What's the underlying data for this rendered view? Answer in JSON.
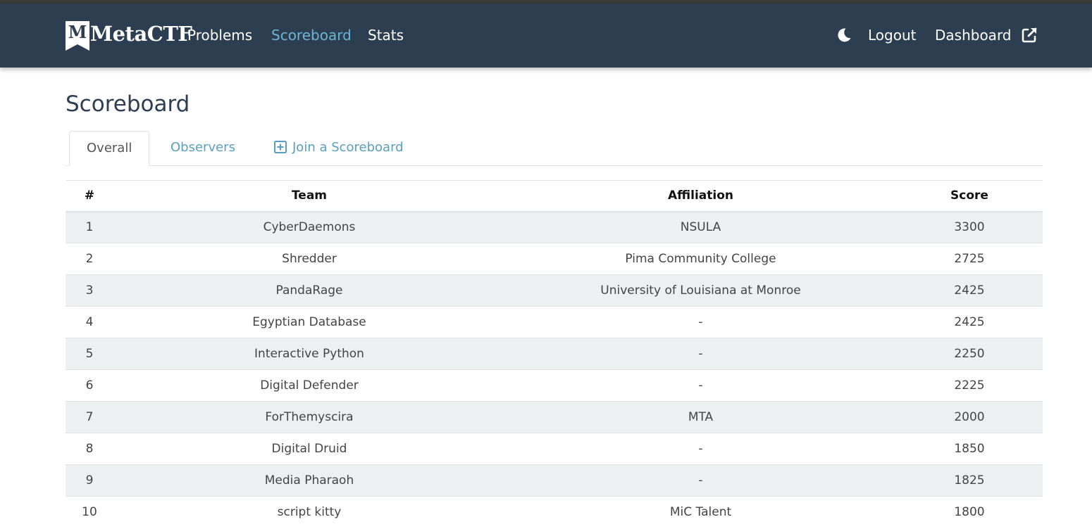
{
  "brand": {
    "logo_text": "MetaCTF"
  },
  "nav": {
    "problems": "Problems",
    "scoreboard": "Scoreboard",
    "stats": "Stats",
    "logout": "Logout",
    "dashboard": "Dashboard",
    "theme_icon": "moon-icon",
    "external_icon": "external-link-icon"
  },
  "colors": {
    "navbar": "#2c3e50",
    "active_link": "#6db5d6",
    "stripe": "#ecf0f1"
  },
  "page": {
    "title": "Scoreboard"
  },
  "tabs": [
    {
      "label": "Overall",
      "active": true
    },
    {
      "label": "Observers",
      "active": false
    },
    {
      "label": "Join a Scoreboard",
      "active": false,
      "icon": "plus-square-icon"
    }
  ],
  "table": {
    "headers": {
      "rank": "#",
      "team": "Team",
      "affiliation": "Affiliation",
      "score": "Score"
    },
    "rows": [
      {
        "rank": "1",
        "team": "CyberDaemons",
        "affiliation": "NSULA",
        "score": "3300"
      },
      {
        "rank": "2",
        "team": "Shredder",
        "affiliation": "Pima Community College",
        "score": "2725"
      },
      {
        "rank": "3",
        "team": "PandaRage",
        "affiliation": "University of Louisiana at Monroe",
        "score": "2425"
      },
      {
        "rank": "4",
        "team": "Egyptian Database",
        "affiliation": "-",
        "score": "2425"
      },
      {
        "rank": "5",
        "team": "Interactive Python",
        "affiliation": "-",
        "score": "2250"
      },
      {
        "rank": "6",
        "team": "Digital Defender",
        "affiliation": "-",
        "score": "2225"
      },
      {
        "rank": "7",
        "team": "ForThemyscira",
        "affiliation": "MTA",
        "score": "2000"
      },
      {
        "rank": "8",
        "team": "Digital Druid",
        "affiliation": "-",
        "score": "1850"
      },
      {
        "rank": "9",
        "team": "Media Pharaoh",
        "affiliation": "-",
        "score": "1825"
      },
      {
        "rank": "10",
        "team": "script kitty",
        "affiliation": "MiC Talent",
        "score": "1800"
      }
    ]
  }
}
